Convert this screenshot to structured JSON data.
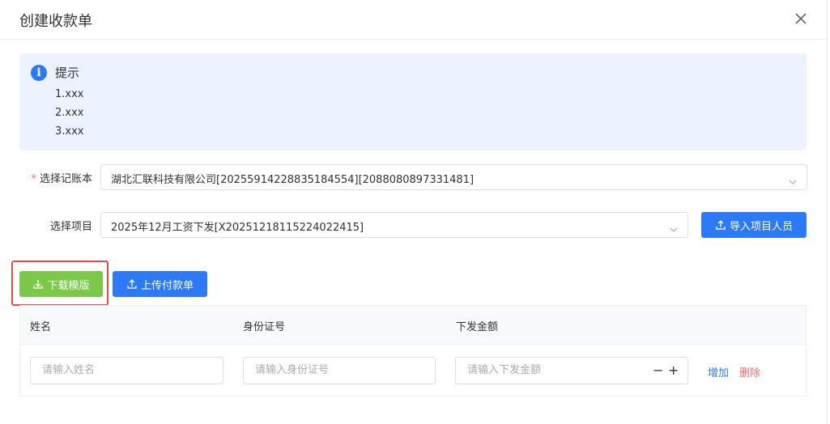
{
  "dialog": {
    "title": "创建收款单"
  },
  "tip": {
    "title": "提示",
    "lines": [
      "1.xxx",
      "2.xxx",
      "3.xxx"
    ]
  },
  "form": {
    "ledger": {
      "label": "选择记账本",
      "required_mark": "*",
      "value": "湖北汇联科技有限公司[20255914228835184554][2088080897331481]"
    },
    "project": {
      "label": "选择项目",
      "value": "2025年12月工资下发[X20251218115224022415]"
    }
  },
  "buttons": {
    "import_staff": "导入项目人员",
    "download_template": "下载模版",
    "upload_payment": "上传付款单"
  },
  "table": {
    "columns": [
      "姓名",
      "身份证号",
      "下发金额"
    ],
    "row": {
      "name_placeholder": "请输入姓名",
      "id_placeholder": "请输入身份证号",
      "amount_placeholder": "请输入下发金额",
      "minus": "−",
      "plus": "+",
      "add_label": "增加",
      "delete_label": "删除"
    }
  },
  "colors": {
    "primary": "#2c7af8",
    "success": "#7cc94a",
    "danger": "#f56c6c",
    "tip_bg": "#ecf3fe",
    "highlight": "#e54d42"
  },
  "icons": {
    "close": "close-icon",
    "info": "info-icon",
    "chevron": "chevron-down-icon",
    "upload": "upload-icon",
    "download": "download-icon"
  }
}
